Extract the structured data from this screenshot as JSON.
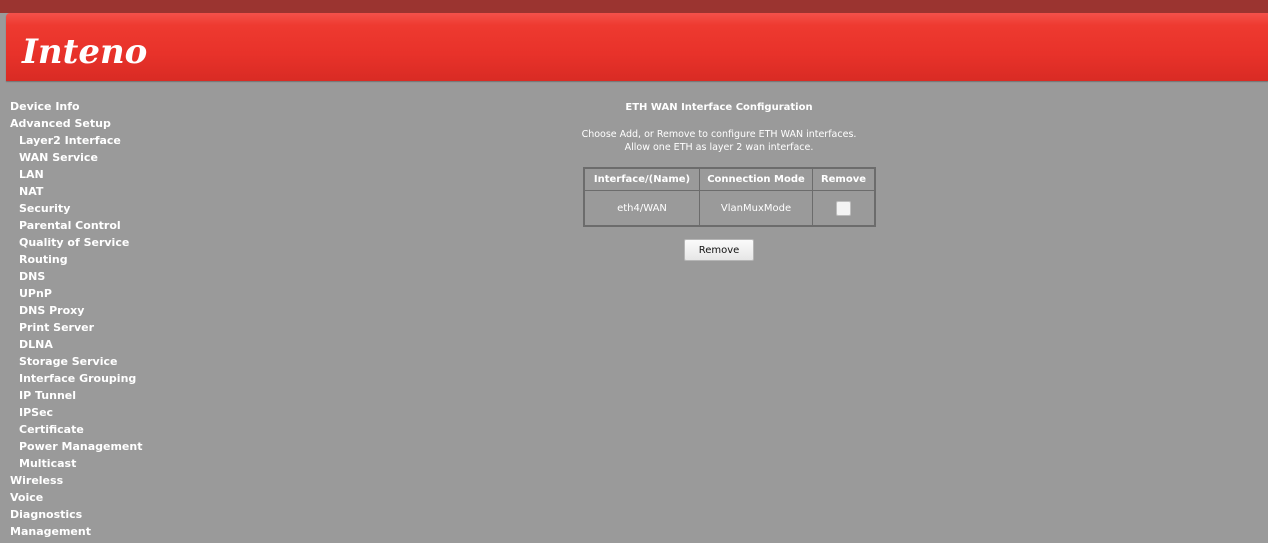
{
  "app": {
    "logo_text": "Inteno",
    "brand_color": "#e8322a",
    "background_color": "#9a9a9a"
  },
  "sidebar": {
    "items": [
      {
        "label": "Device Info",
        "level": 0
      },
      {
        "label": "Advanced Setup",
        "level": 0
      },
      {
        "label": "Layer2 Interface",
        "level": 1
      },
      {
        "label": "WAN Service",
        "level": 1
      },
      {
        "label": "LAN",
        "level": 1
      },
      {
        "label": "NAT",
        "level": 1
      },
      {
        "label": "Security",
        "level": 1
      },
      {
        "label": "Parental Control",
        "level": 1
      },
      {
        "label": "Quality of Service",
        "level": 1
      },
      {
        "label": "Routing",
        "level": 1
      },
      {
        "label": "DNS",
        "level": 1
      },
      {
        "label": "UPnP",
        "level": 1
      },
      {
        "label": "DNS Proxy",
        "level": 1
      },
      {
        "label": "Print Server",
        "level": 1
      },
      {
        "label": "DLNA",
        "level": 1
      },
      {
        "label": "Storage Service",
        "level": 1
      },
      {
        "label": "Interface Grouping",
        "level": 1
      },
      {
        "label": "IP Tunnel",
        "level": 1
      },
      {
        "label": "IPSec",
        "level": 1
      },
      {
        "label": "Certificate",
        "level": 1
      },
      {
        "label": "Power Management",
        "level": 1
      },
      {
        "label": "Multicast",
        "level": 1
      },
      {
        "label": "Wireless",
        "level": 0
      },
      {
        "label": "Voice",
        "level": 0
      },
      {
        "label": "Diagnostics",
        "level": 0
      },
      {
        "label": "Management",
        "level": 0
      }
    ]
  },
  "main": {
    "title": "ETH WAN Interface Configuration",
    "description_line1": "Choose Add, or Remove to configure ETH WAN interfaces.",
    "description_line2": "Allow one ETH as layer 2 wan interface.",
    "table": {
      "headers": [
        "Interface/(Name)",
        "Connection Mode",
        "Remove"
      ],
      "rows": [
        {
          "interface": "eth4/WAN",
          "mode": "VlanMuxMode",
          "remove_checked": false
        }
      ]
    },
    "remove_button_label": "Remove"
  }
}
